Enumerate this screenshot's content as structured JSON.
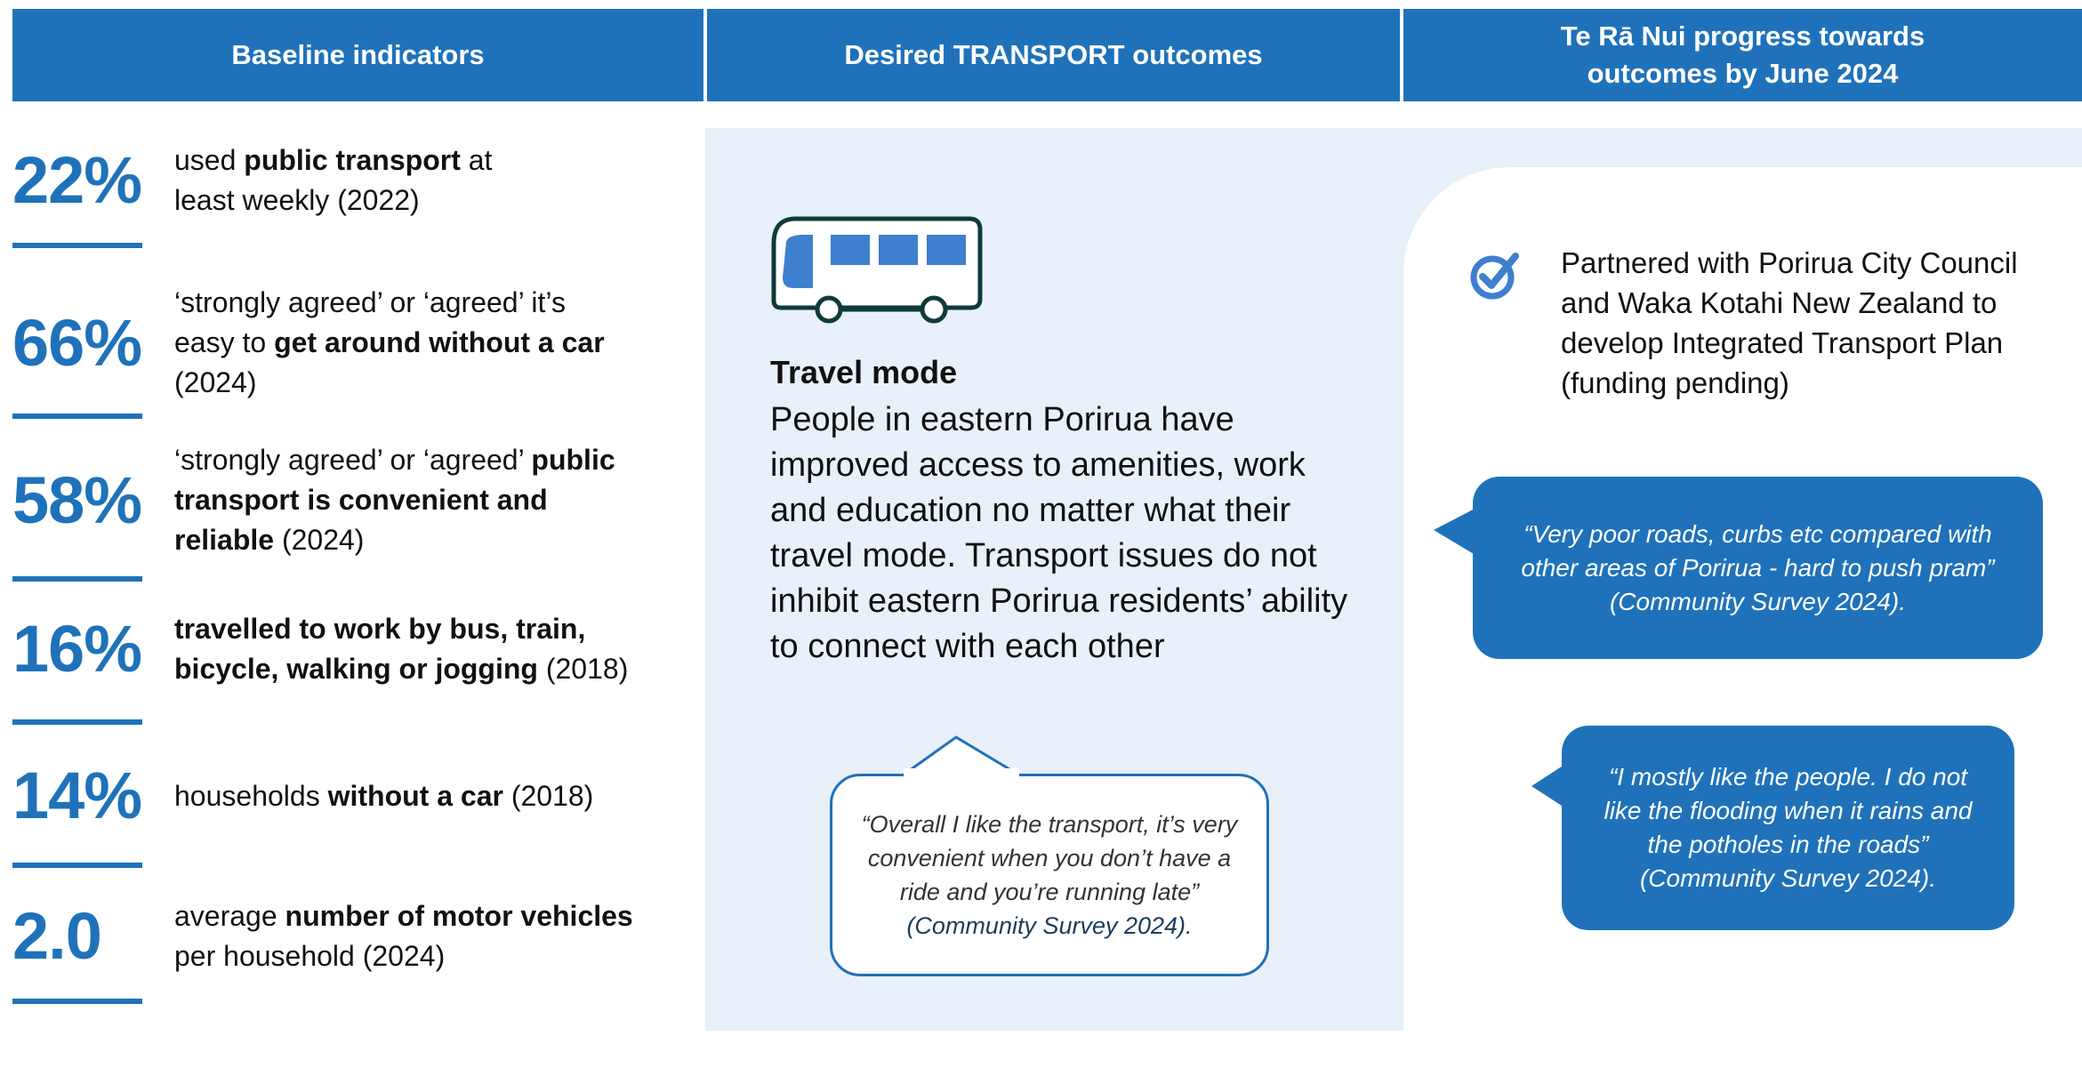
{
  "header": {
    "col1": "Baseline indicators",
    "col2": "Desired TRANSPORT outcomes",
    "col3_line1": "Te Rā Nui progress towards",
    "col3_line2": "outcomes by June 2024"
  },
  "indicators": [
    {
      "value": "22%",
      "pre": "used ",
      "bold": "public transport",
      "post": " at least weekly (2022)"
    },
    {
      "value": "66%",
      "pre": "‘strongly agreed’ or ‘agreed’ it’s easy to ",
      "bold": "get around without a car",
      "post": " (2024)"
    },
    {
      "value": "58%",
      "pre": "‘strongly agreed’ or ‘agreed’ ",
      "bold": "public transport is convenient and reliable",
      "post": " (2024)"
    },
    {
      "value": "16%",
      "pre": "",
      "bold": "travelled to work by bus, train, bicycle, walking or jogging",
      "post": " (2018)"
    },
    {
      "value": "14%",
      "pre": "households ",
      "bold": "without a car",
      "post": " (2018)"
    },
    {
      "value": "2.0",
      "pre": "average ",
      "bold": "number of motor vehicles",
      "post": " per household (2024)"
    }
  ],
  "outcome": {
    "icon": "bus-icon",
    "title": "Travel mode",
    "body": "People in eastern Porirua have improved access to amenities, work and education no matter what their travel mode. Transport issues do not inhibit eastern Porirua residents’ ability to connect with each other"
  },
  "quote_center": {
    "text": "“Overall I like the transport, it’s very convenient when you don’t have a ride and you’re running late”",
    "source": "(Community Survey 2024)."
  },
  "progress": {
    "icon": "check-circle-icon",
    "text": "Partnered with Porirua City Council and Waka Kotahi New Zealand to develop Integrated Transport Plan (funding pending)"
  },
  "quotes_right": [
    {
      "text": "“Very poor roads, curbs etc compared with other areas of Porirua - hard to push pram”",
      "source": "(Community Survey 2024)."
    },
    {
      "text": "“I mostly like the people. I do not like the flooding when it rains and the potholes in the roads”",
      "source": "(Community Survey 2024)."
    }
  ],
  "colors": {
    "brand_blue": "#1f72b9",
    "panel_bg": "#e8f0f9",
    "icon_dark": "#0f3a3a"
  }
}
